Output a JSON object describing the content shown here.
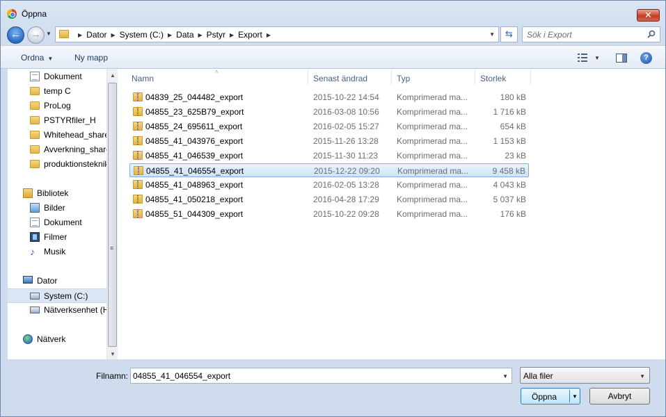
{
  "window": {
    "title": "Öppna",
    "close_label": "✕"
  },
  "navigation": {
    "breadcrumbs": [
      "Dator",
      "System (C:)",
      "Data",
      "Pstyr",
      "Export"
    ],
    "search_placeholder": "Sök i Export"
  },
  "toolbar": {
    "organize_label": "Ordna",
    "new_folder_label": "Ny mapp"
  },
  "nav_pane": {
    "favorites": [
      {
        "label": "Dokument",
        "icon": "document-icon"
      },
      {
        "label": "temp C",
        "icon": "folder-icon"
      },
      {
        "label": "ProLog",
        "icon": "folder-icon"
      },
      {
        "label": "PSTYRfiler_H",
        "icon": "folder-icon"
      },
      {
        "label": "Whitehead_share",
        "icon": "folder-icon"
      },
      {
        "label": "Avverkning_share",
        "icon": "folder-icon"
      },
      {
        "label": "produktionsteknik",
        "icon": "folder-icon"
      }
    ],
    "libraries": {
      "label": "Bibliotek",
      "items": [
        {
          "label": "Bilder",
          "icon": "pictures-icon"
        },
        {
          "label": "Dokument",
          "icon": "document-icon"
        },
        {
          "label": "Filmer",
          "icon": "film-icon"
        },
        {
          "label": "Musik",
          "icon": "music-icon"
        }
      ]
    },
    "computer": {
      "label": "Dator",
      "items": [
        {
          "label": "System (C:)",
          "icon": "drive-icon",
          "selected": true
        },
        {
          "label": "Nätverksenhet (H:)",
          "icon": "network-drive-icon"
        }
      ]
    },
    "network": {
      "label": "Nätverk"
    }
  },
  "file_list": {
    "columns": [
      "Namn",
      "Senast ändrad",
      "Typ",
      "Storlek"
    ],
    "rows": [
      {
        "name": "04839_25_044482_export",
        "modified": "2015-10-22 14:54",
        "type": "Komprimerad ma...",
        "size": "180 kB"
      },
      {
        "name": "04855_23_625B79_export",
        "modified": "2016-03-08 10:56",
        "type": "Komprimerad ma...",
        "size": "1 716 kB"
      },
      {
        "name": "04855_24_695611_export",
        "modified": "2016-02-05 15:27",
        "type": "Komprimerad ma...",
        "size": "654 kB"
      },
      {
        "name": "04855_41_043976_export",
        "modified": "2015-11-26 13:28",
        "type": "Komprimerad ma...",
        "size": "1 153 kB"
      },
      {
        "name": "04855_41_046539_export",
        "modified": "2015-11-30 11:23",
        "type": "Komprimerad ma...",
        "size": "23 kB"
      },
      {
        "name": "04855_41_046554_export",
        "modified": "2015-12-22 09:20",
        "type": "Komprimerad ma...",
        "size": "9 458 kB",
        "selected": true
      },
      {
        "name": "04855_41_048963_export",
        "modified": "2016-02-05 13:28",
        "type": "Komprimerad ma...",
        "size": "4 043 kB"
      },
      {
        "name": "04855_41_050218_export",
        "modified": "2016-04-28 17:29",
        "type": "Komprimerad ma...",
        "size": "5 037 kB"
      },
      {
        "name": "04855_51_044309_export",
        "modified": "2015-10-22 09:28",
        "type": "Komprimerad ma...",
        "size": "176 kB"
      }
    ]
  },
  "footer": {
    "filename_label": "Filnamn:",
    "filename_value": "04855_41_046554_export",
    "filter_label": "Alla filer",
    "open_label": "Öppna",
    "cancel_label": "Avbryt"
  }
}
